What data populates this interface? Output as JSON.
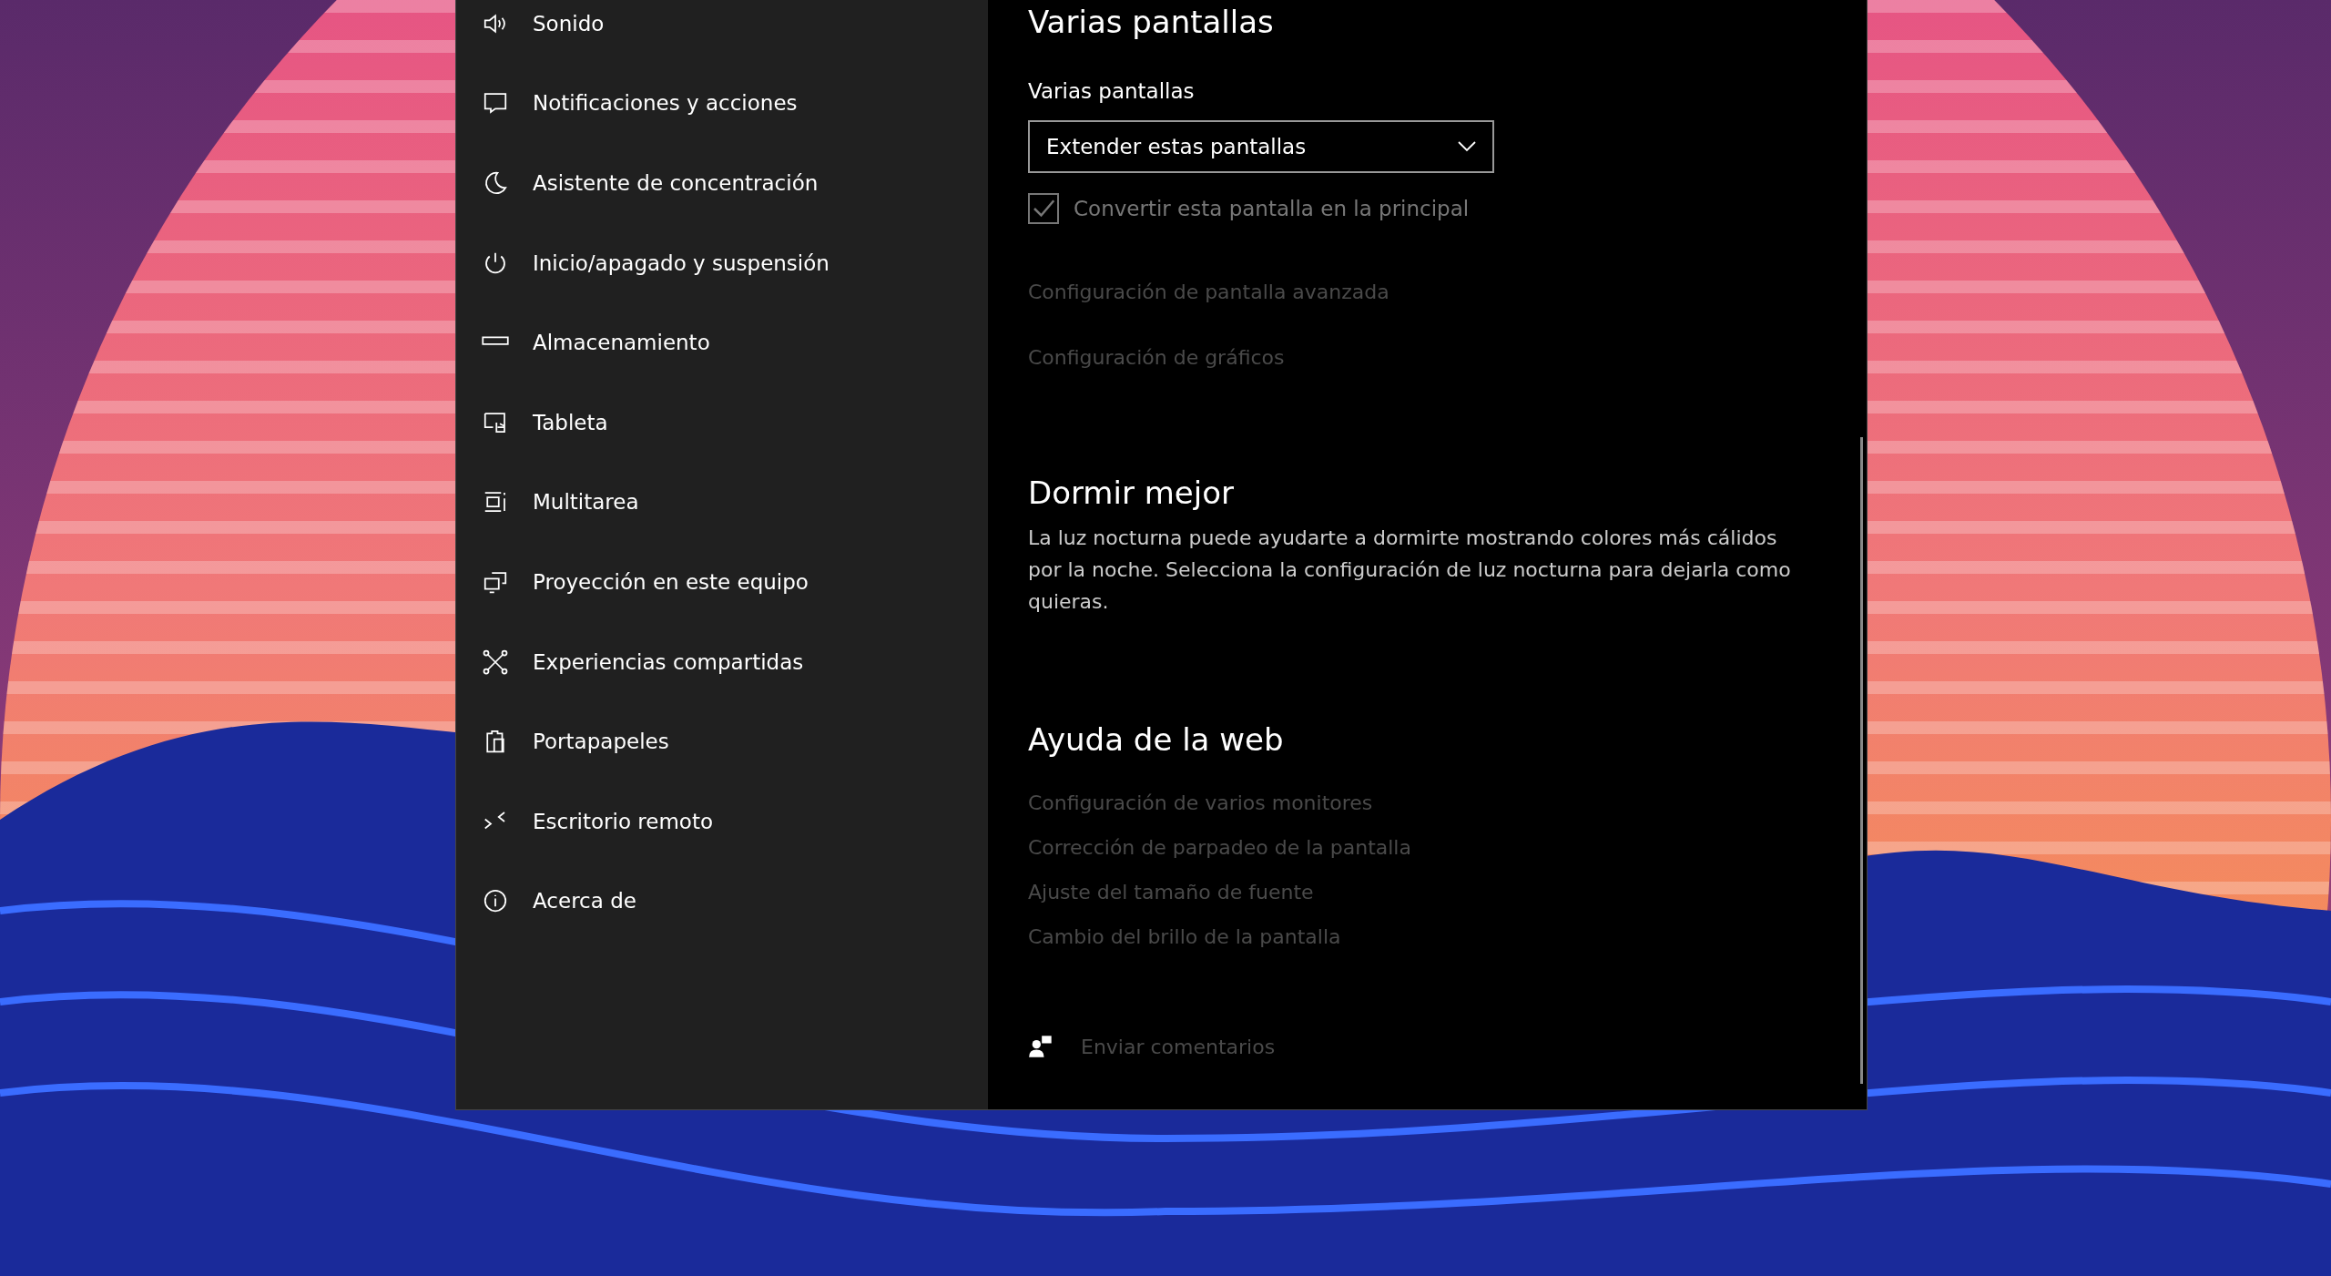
{
  "sidebar": {
    "items": [
      {
        "label": "Sonido"
      },
      {
        "label": "Notificaciones y acciones"
      },
      {
        "label": "Asistente de concentración"
      },
      {
        "label": "Inicio/apagado y suspensión"
      },
      {
        "label": "Almacenamiento"
      },
      {
        "label": "Tableta"
      },
      {
        "label": "Multitarea"
      },
      {
        "label": "Proyección en este equipo"
      },
      {
        "label": "Experiencias compartidas"
      },
      {
        "label": "Portapapeles"
      },
      {
        "label": "Escritorio remoto"
      },
      {
        "label": "Acerca de"
      }
    ]
  },
  "multiple_displays": {
    "heading": "Varias pantallas",
    "label": "Varias pantallas",
    "dropdown": {
      "value": "Extender estas pantallas"
    },
    "checkbox": {
      "label": "Convertir esta pantalla en la principal",
      "checked": true,
      "disabled": true
    },
    "links": [
      "Configuración de pantalla avanzada",
      "Configuración de gráficos"
    ]
  },
  "sleep_better": {
    "heading": "Dormir mejor",
    "text": "La luz nocturna puede ayudarte a dormirte mostrando colores más cálidos por la noche. Selecciona la configuración de luz nocturna para dejarla como quieras."
  },
  "web_help": {
    "heading": "Ayuda de la web",
    "links": [
      "Configuración de varios monitores",
      "Corrección de parpadeo de la pantalla",
      "Ajuste del tamaño de fuente",
      "Cambio del brillo de la pantalla"
    ]
  },
  "feedback": {
    "label": "Enviar comentarios"
  }
}
